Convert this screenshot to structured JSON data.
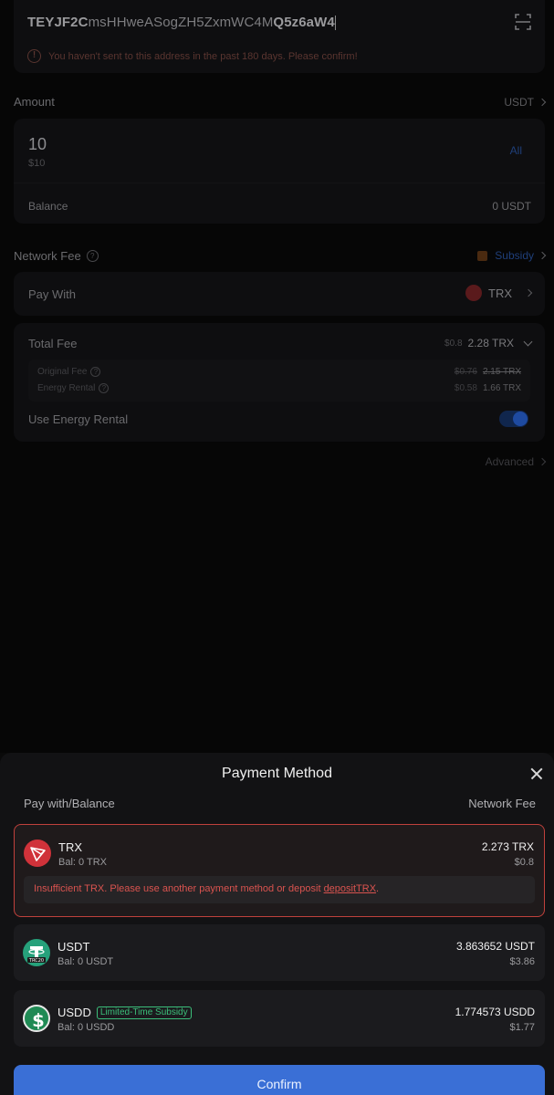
{
  "address": {
    "prefix": "TEYJF2C",
    "middle": "msHHweASogZH5ZxmWC4M",
    "suffix": "Q5z6aW4",
    "warning": "You haven't sent to this address in the past 180 days. Please confirm!"
  },
  "amount": {
    "label": "Amount",
    "unit": "USDT",
    "value": "10",
    "usd": "$10",
    "all_label": "All",
    "balance_label": "Balance",
    "balance_value": "0 USDT"
  },
  "network_fee": {
    "label": "Network Fee",
    "subsidy_label": "Subsidy",
    "pay_with_label": "Pay With",
    "pay_with_value": "TRX",
    "total_fee_label": "Total Fee",
    "total_fee_usd": "$0.8",
    "total_fee_value": "2.28 TRX",
    "original_fee_label": "Original Fee",
    "original_fee_usd": "$0.76",
    "original_fee_value": "2.15 TRX",
    "energy_rental_label": "Energy Rental",
    "energy_rental_usd": "$0.58",
    "energy_rental_value": "1.66 TRX",
    "use_energy_label": "Use Energy Rental",
    "use_energy_on": true,
    "advanced_label": "Advanced"
  },
  "sheet": {
    "title": "Payment Method",
    "col_left": "Pay with/Balance",
    "col_right": "Network Fee",
    "options": [
      {
        "name": "TRX",
        "balance": "Bal: 0 TRX",
        "fee": "2.273 TRX",
        "usd": "$0.8",
        "selected": true,
        "error_text": "Insufficient TRX. Please use another payment method or deposit ",
        "error_link": "depositTRX",
        "error_end": "."
      },
      {
        "name": "USDT",
        "balance": "Bal: 0 USDT",
        "fee": "3.863652 USDT",
        "usd": "$3.86",
        "icon_label": "TRC20"
      },
      {
        "name": "USDD",
        "badge": "Limited-Time Subsidy",
        "balance": "Bal: 0 USDD",
        "fee": "1.774573 USDD",
        "usd": "$1.77"
      }
    ],
    "confirm_label": "Confirm"
  },
  "colors": {
    "accent": "#3a6fd6",
    "error": "#d9534f",
    "subsidy": "#3bbf7a"
  }
}
